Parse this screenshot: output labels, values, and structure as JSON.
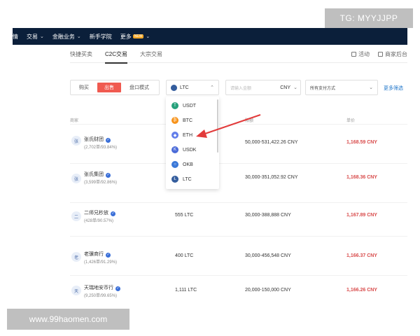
{
  "topnav": {
    "items": [
      {
        "label": "情",
        "has_menu": false
      },
      {
        "label": "交易",
        "has_menu": true
      },
      {
        "label": "金融业务",
        "has_menu": true
      },
      {
        "label": "新手学院",
        "has_menu": false
      },
      {
        "label": "更多",
        "has_menu": true,
        "badge": "NEW"
      }
    ]
  },
  "subnav": {
    "tabs": [
      {
        "label": "快捷买卖",
        "active": false
      },
      {
        "label": "C2C交易",
        "active": true
      },
      {
        "label": "大宗交易",
        "active": false
      }
    ],
    "activity": "活动",
    "merchant": "商家后台"
  },
  "filters": {
    "buy": "购买",
    "sell": "出售",
    "block": "盘口模式",
    "coin": "LTC",
    "amount_placeholder": "请输入金额",
    "currency": "CNY",
    "payment": "所有支付方式",
    "more": "更多筛选"
  },
  "dropdown": {
    "options": [
      {
        "label": "USDT",
        "color": "#26a17b"
      },
      {
        "label": "BTC",
        "color": "#f7931a"
      },
      {
        "label": "ETH",
        "color": "#627eea"
      },
      {
        "label": "USDK",
        "color": "#4a6ad8"
      },
      {
        "label": "OKB",
        "color": "#3a78d8"
      },
      {
        "label": "LTC",
        "color": "#345d9d"
      }
    ]
  },
  "table": {
    "headers": {
      "merchant": "商家",
      "limit": "限额",
      "price": "单价"
    },
    "rows": [
      {
        "avatar": "张",
        "name": "张氏财团",
        "stats": "(2,702单/93.84%)",
        "qty": "",
        "limit": "50,000-531,422.26 CNY",
        "price": "1,168.59 CNY"
      },
      {
        "avatar": "张",
        "name": "张氏集团",
        "stats": "(3,599单/92.86%)",
        "qty": "",
        "limit": "30,000-351,052.92 CNY",
        "price": "1,168.36 CNY"
      },
      {
        "avatar": "二",
        "name": "二师兄秒放",
        "stats": "(428单/90.57%)",
        "qty": "555 LTC",
        "limit": "30,000-388,888 CNY",
        "price": "1,167.89 CNY"
      },
      {
        "avatar": "老",
        "name": "老骥商行",
        "stats": "(1,426单/91.29%)",
        "qty": "400 LTC",
        "limit": "30,000-456,548 CNY",
        "price": "1,166.37 CNY"
      },
      {
        "avatar": "天",
        "name": "天瑞地安币行",
        "stats": "(9,250单/99.65%)",
        "qty": "1,111 LTC",
        "limit": "20,000-150,000 CNY",
        "price": "1,166.26 CNY"
      }
    ]
  },
  "watermarks": {
    "tg": "TG: MYYJJPP",
    "site": "www.99haomen.com"
  },
  "colors": {
    "nav_bg": "#0b1f3a",
    "sell_active": "#f05a50",
    "price": "#d84a4a",
    "link": "#1c74c9",
    "arrow": "#e23b3b"
  }
}
